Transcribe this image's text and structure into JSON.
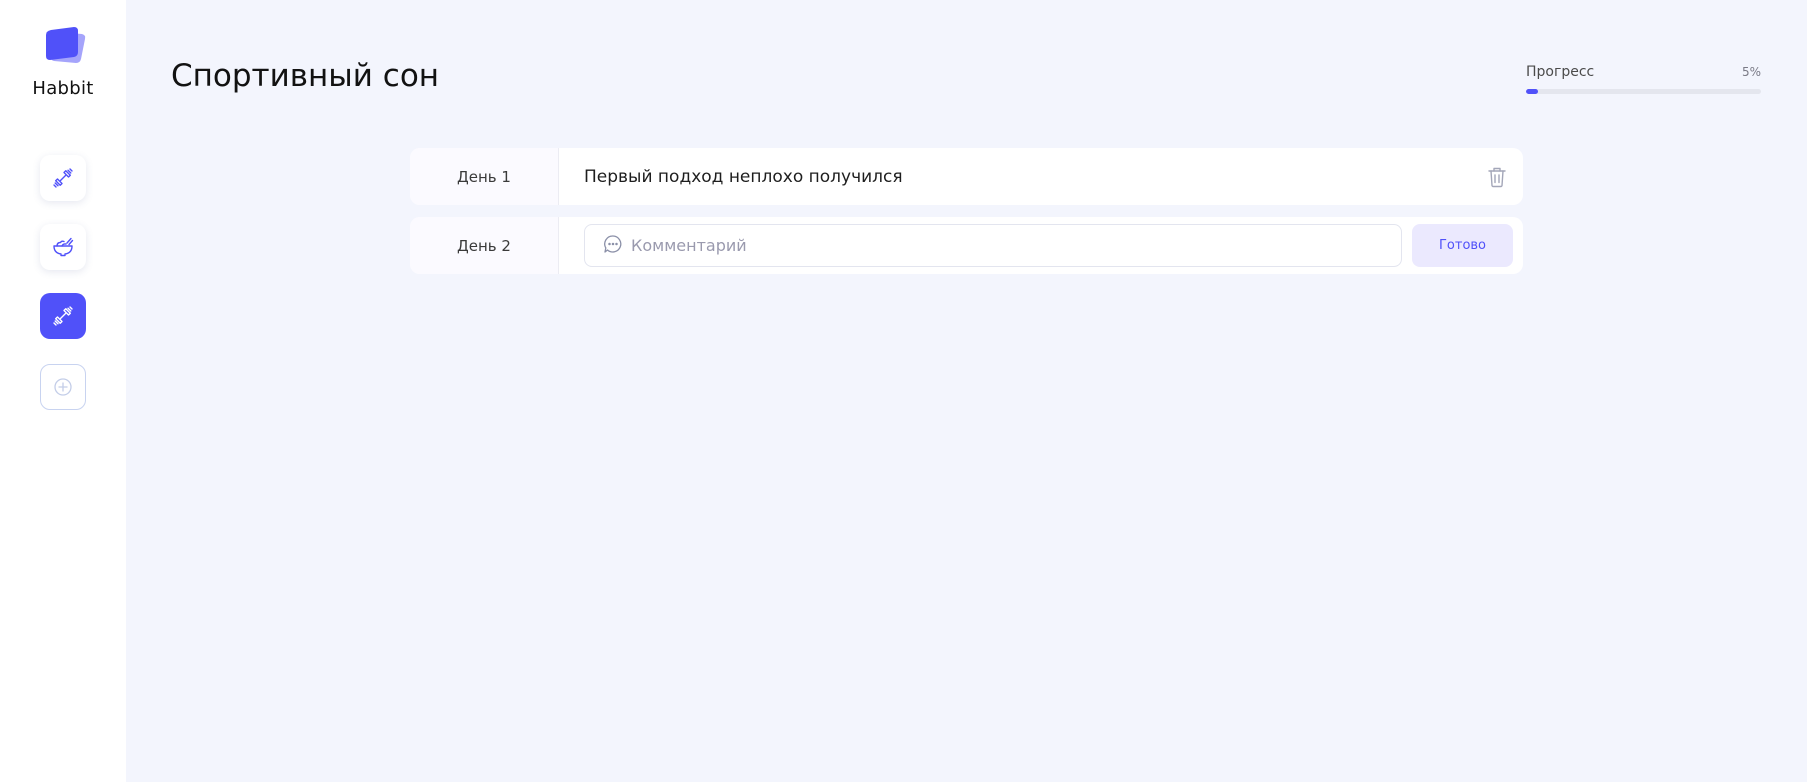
{
  "app": {
    "name": "Habbit"
  },
  "sidebar": {
    "items": [
      {
        "icon": "dumbbell-icon",
        "active": false
      },
      {
        "icon": "food-bowl-icon",
        "active": false
      },
      {
        "icon": "dumbbell-icon",
        "active": true
      },
      {
        "icon": "add-circle-icon",
        "active": false
      }
    ]
  },
  "header": {
    "title": "Спортивный сон",
    "progress_label": "Прогресс",
    "progress_value": "5%",
    "progress_fraction": 0.05
  },
  "days": [
    {
      "label": "День 1",
      "comment": "Первый подход неплохо получился"
    },
    {
      "label": "День 2",
      "comment_placeholder": "Комментарий",
      "comment_value": "",
      "submit_label": "Готово"
    }
  ],
  "colors": {
    "accent": "#5051f9",
    "background": "#f3f5fd",
    "sidebar": "#ffffff",
    "done_button_bg": "#ebe9fe"
  }
}
